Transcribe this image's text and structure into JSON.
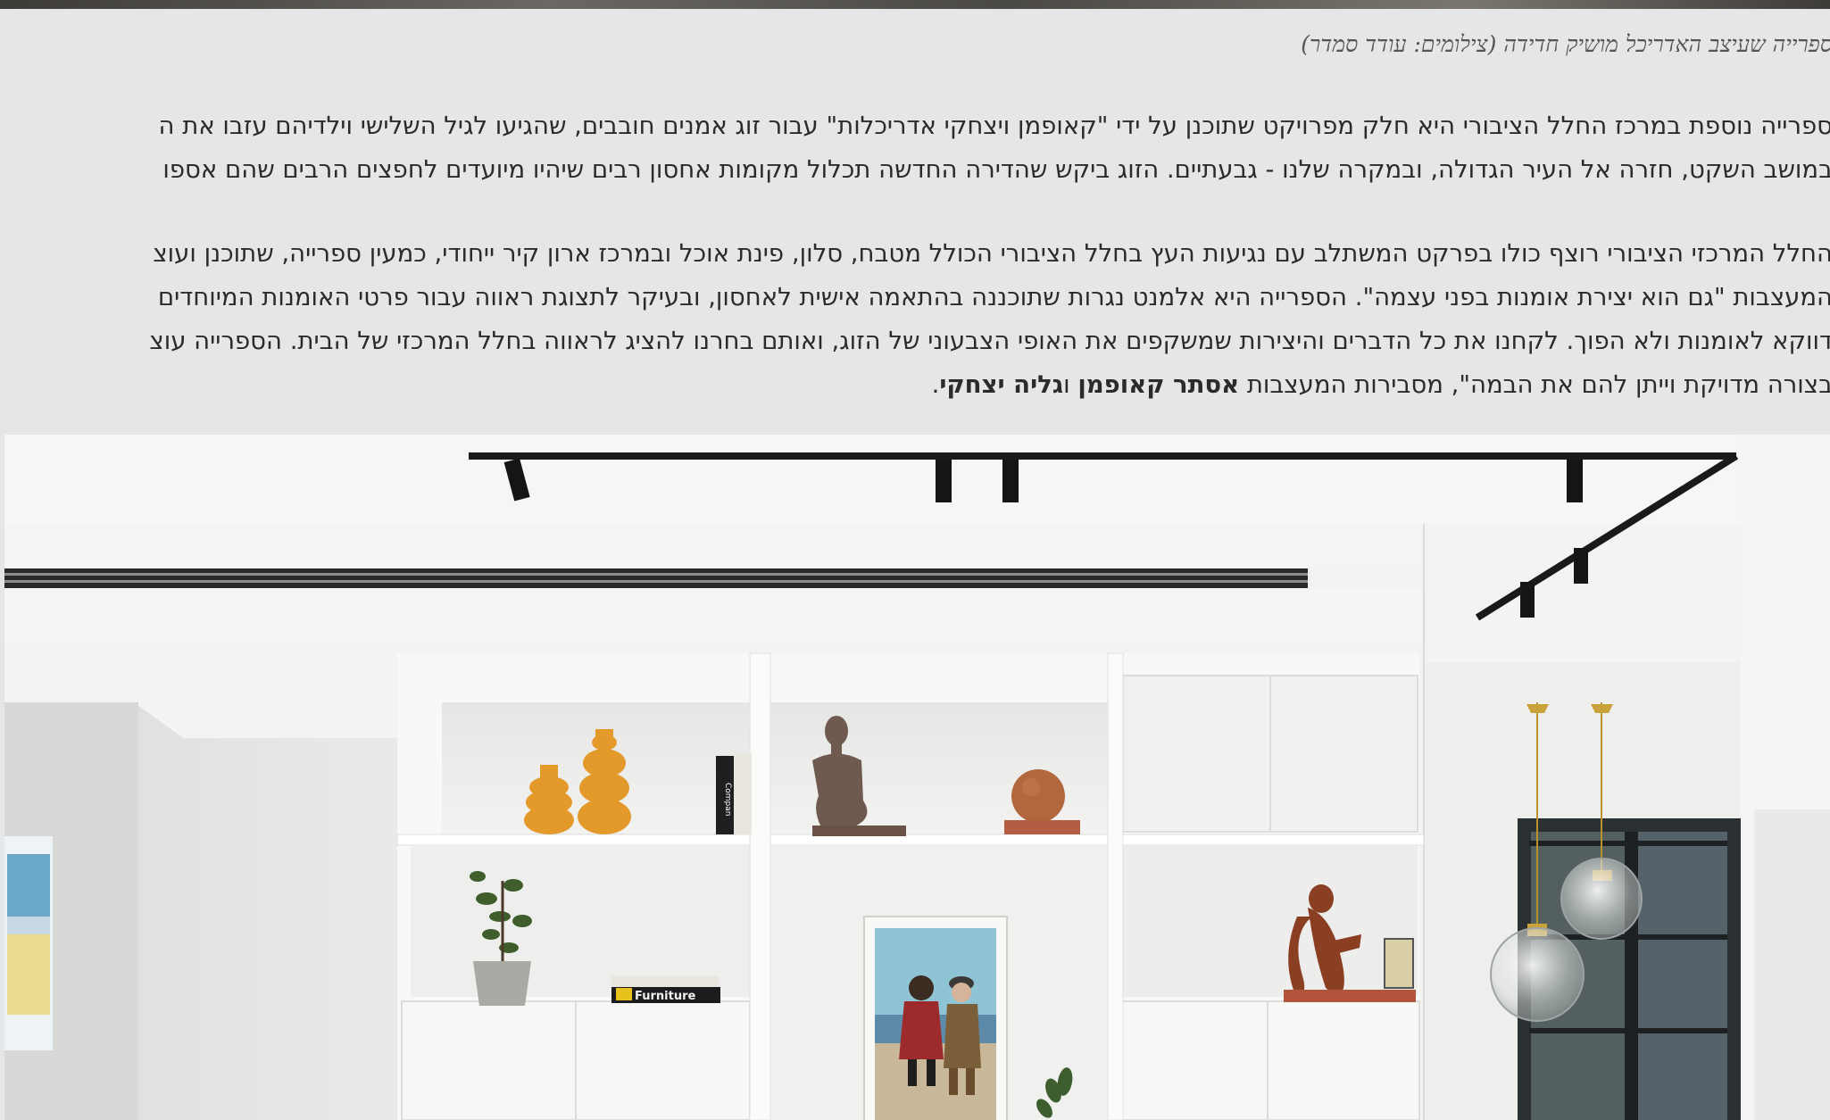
{
  "caption": "ספרייה שעיצב האדריכל מושיק חדידה (צילומים: עודד סמדר)",
  "article": {
    "paragraph1": [
      "ספרייה נוספת במרכז החלל הציבורי היא חלק מפרויקט שתוכנן על ידי \"קאופמן ויצחקי אדריכלות\" עבור זוג אמנים חובבים, שהגיעו לגיל השלישי וילדיהם עזבו את ה",
      "במושב השקט, חזרה אל העיר הגדולה, ובמקרה שלנו - גבעתיים. הזוג ביקש שהדירה החדשה תכלול מקומות אחסון רבים שיהיו מיועדים לחפצים הרבים שהם אספו"
    ],
    "paragraph2": [
      "החלל המרכזי הציבורי רוצף כולו בפרקט המשתלב עם נגיעות העץ בחלל הציבורי הכולל מטבח, סלון, פינת אוכל ובמרכז ארון קיר ייחודי, כמעין ספרייה, שתוכנן ועוצ",
      "המעצבות \"גם הוא יצירת אומנות בפני עצמה\". הספרייה היא אלמנט נגרות שתוכננה בהתאמה אישית לאחסון, ובעיקר לתצוגת ראווה עבור פרטי האומנות המיוחדים",
      "דווקא לאומנות ולא הפוך. לקחנו את כל הדברים והיצירות שמשקפים את האופי הצבעוני של הזוג, ואותם בחרנו להציג לראווה בחלל המרכזי של הבית. הספרייה עוצ"
    ],
    "paragraph2_last": {
      "text_before": "בצורה מדויקת וייתן להם את הבמה\", מסבירות המעצבות ",
      "name1": "אסתר קאופמן",
      "connector": " ו",
      "name2": "גליה יצחקי",
      "text_after": "."
    }
  },
  "photo": {
    "book_label_1": "Compan",
    "book_label_2": "Furniture"
  },
  "colors": {
    "background": "#e4e6e7",
    "text": "#2b2b2b",
    "caption": "#555555",
    "vase": "#e39a2a",
    "sculpture_clay": "#8a3e22"
  }
}
